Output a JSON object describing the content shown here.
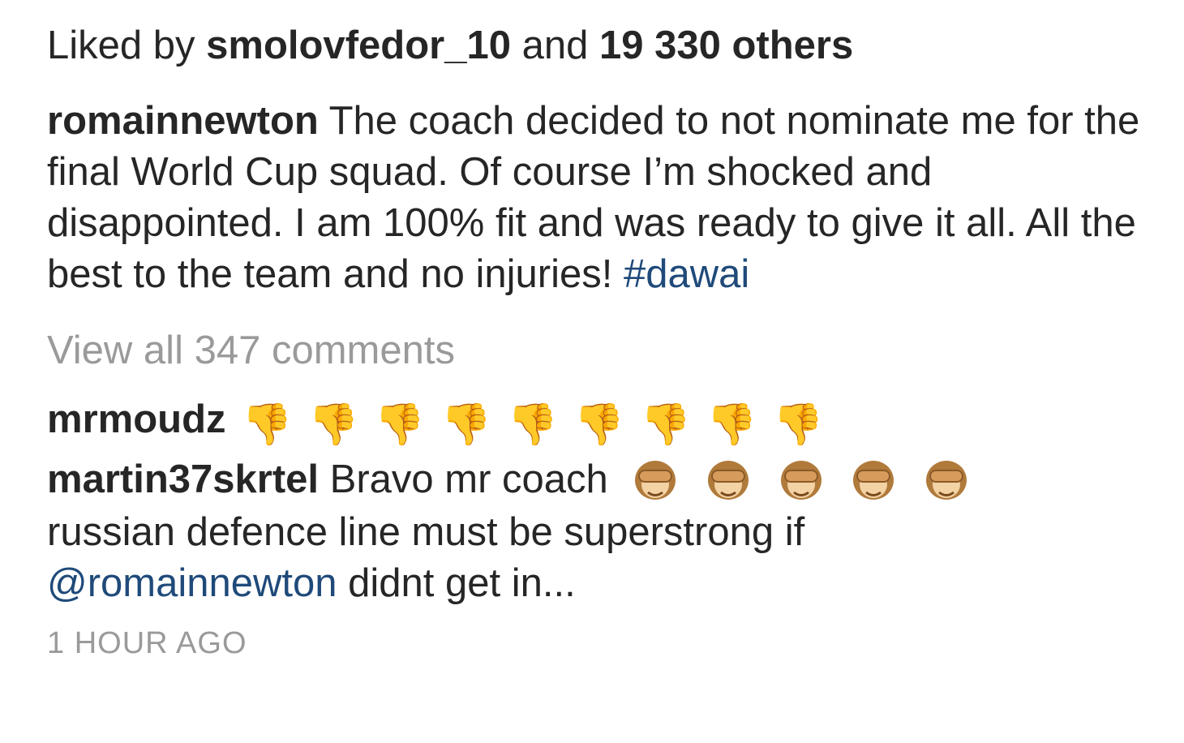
{
  "likes": {
    "prefix": "Liked by",
    "user": "smolovfedor_10",
    "joiner": "and",
    "others": "19 330 others"
  },
  "caption": {
    "username": "romainnewton",
    "text": "The coach decided to not nominate me for the final World Cup squad. Of course I’m shocked and disappointed. I am 100% fit and was ready to give it all. All the best to the team and no injuries!",
    "hashtag": "#dawai"
  },
  "view_all_comments": "View all 347 comments",
  "comments": [
    {
      "username": "mrmoudz",
      "text": "",
      "emoji": "thumbs-down-icon",
      "emoji_count": 9
    },
    {
      "username": "martin37skrtel",
      "text_before": "Bravo mr coach",
      "emoji": "see-no-evil-monkey-icon",
      "emoji_count": 5,
      "text_after": "russian defence line must be superstrong if",
      "mention": "@romainnewton",
      "text_end": "didnt get in..."
    }
  ],
  "timestamp": "1 HOUR AGO",
  "colors": {
    "text": "#262626",
    "link": "#1f4a7a",
    "muted": "#9a9a9a",
    "emoji_skin": "#f2c9a3",
    "monkey_fur": "#b07a3b",
    "monkey_face": "#f3d2a4"
  }
}
